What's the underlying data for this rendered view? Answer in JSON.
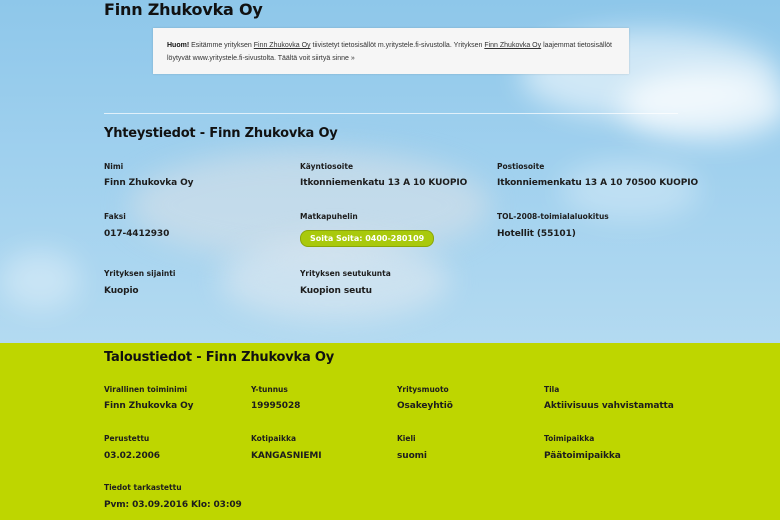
{
  "company_title": "Finn Zhukovka Oy",
  "notice": {
    "strong": "Huom!",
    "text1": " Esitämme yrityksen ",
    "link1": "Finn Zhukovka Oy",
    "text2": " tiivistetyt tietosisällöt m.yritystele.fi-sivustolla. Yrityksen ",
    "link2": "Finn Zhukovka Oy",
    "text3": " laajemmat tietosisällöt löytyvät www.yritystele.fi-sivustolta. ",
    "link3": "Täältä voit siirtyä sinne »"
  },
  "contact": {
    "heading": "Yhteystiedot - Finn Zhukovka Oy",
    "name_label": "Nimi",
    "name_value": "Finn Zhukovka Oy",
    "visit_label": "Käyntiosoite",
    "visit_value": "Itkonniemenkatu 13 A 10 KUOPIO",
    "postal_label": "Postiosoite",
    "postal_value": "Itkonniemenkatu 13 A 10 70500 KUOPIO",
    "fax_label": "Faksi",
    "fax_value": "017-4412930",
    "mobile_label": "Matkapuhelin",
    "call_button": "Soita Soita: 0400-280109",
    "industry_label": "TOL-2008-toimialaluokitus",
    "industry_value": "Hotellit (55101)",
    "location_label": "Yrityksen sijainti",
    "location_value": "Kuopio",
    "region_label": "Yrityksen seutukunta",
    "region_value": "Kuopion seutu"
  },
  "finance": {
    "heading": "Taloustiedot - Finn Zhukovka Oy",
    "official_name_label": "Virallinen toiminimi",
    "official_name_value": "Finn Zhukovka Oy",
    "business_id_label": "Y-tunnus",
    "business_id_value": "19995028",
    "company_form_label": "Yritysmuoto",
    "company_form_value": "Osakeyhtiö",
    "status_label": "Tila",
    "status_value": "Aktiivisuus vahvistamatta",
    "founded_label": "Perustettu",
    "founded_value": "03.02.2006",
    "domicile_label": "Kotipaikka",
    "domicile_value": "KANGASNIEMI",
    "language_label": "Kieli",
    "language_value": "suomi",
    "office_label": "Toimipaikka",
    "office_value": "Päätoimipaikka",
    "checked_label": "Tiedot tarkastettu",
    "checked_value": "Pvm: 03.09.2016 Klo: 03:09"
  },
  "colors": {
    "green_band": "#bed600",
    "call_button": "#a9c90c"
  }
}
